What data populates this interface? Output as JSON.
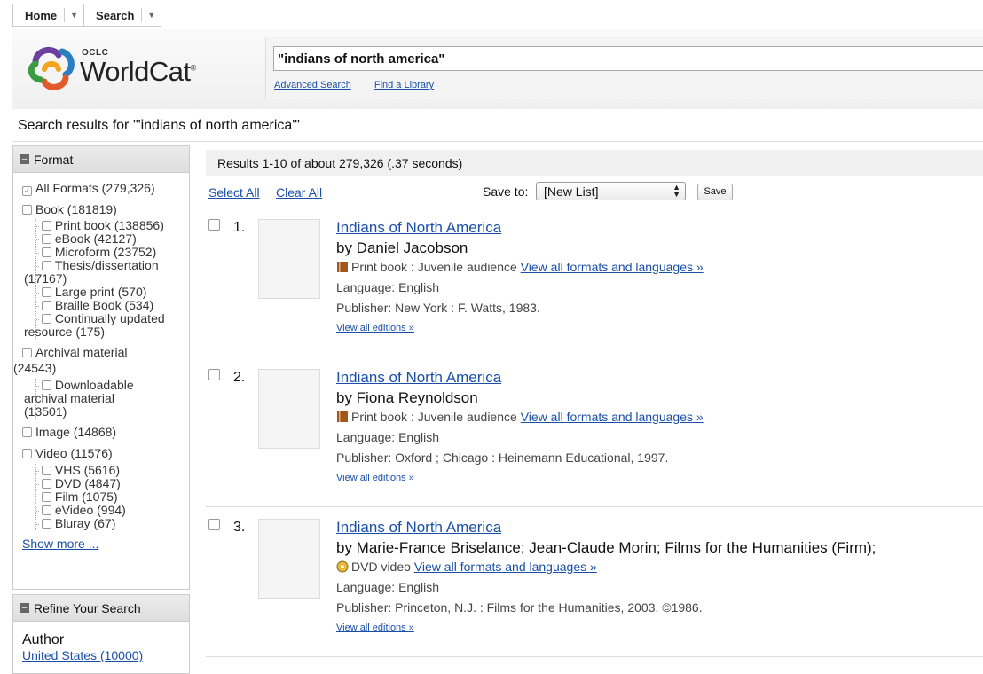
{
  "nav": {
    "home": "Home",
    "search": "Search"
  },
  "brand": {
    "oclc": "OCLC",
    "name": "WorldCat",
    "mark": "®"
  },
  "search": {
    "query": "\"indians of north america\"",
    "advanced": "Advanced Search",
    "find_library": "Find a Library"
  },
  "results_for": "Search results for '\"indians of north america\"'",
  "format_facet": {
    "heading": "Format",
    "items": [
      {
        "label": "All Formats (279,326)",
        "checked": true
      },
      {
        "label": "Book (181819)"
      },
      {
        "label": "Print book (138856)"
      },
      {
        "label": "eBook (42127)"
      },
      {
        "label": "Microform (23752)"
      },
      {
        "label": "Thesis/dissertation"
      },
      {
        "label": "(17167)"
      },
      {
        "label": "Large print (570)"
      },
      {
        "label": "Braille Book (534)"
      },
      {
        "label": "Continually updated"
      },
      {
        "label": "resource (175)"
      },
      {
        "label": "Archival material"
      },
      {
        "label": "(24543)"
      },
      {
        "label": "Downloadable"
      },
      {
        "label": "archival material"
      },
      {
        "label": "(13501)"
      },
      {
        "label": "Image (14868)"
      },
      {
        "label": "Video (11576)"
      },
      {
        "label": "VHS (5616)"
      },
      {
        "label": "DVD (4847)"
      },
      {
        "label": "Film (1075)"
      },
      {
        "label": "eVideo (994)"
      },
      {
        "label": "Bluray (67)"
      }
    ],
    "show_more": "Show more ..."
  },
  "refine": {
    "heading": "Refine Your Search",
    "author": "Author",
    "author_first": "United States (10000)"
  },
  "results": {
    "summary": "Results 1-10 of about 279,326 (.37 seconds)",
    "select_all": "Select All",
    "clear_all": "Clear All",
    "save_to": "Save to:",
    "list_value": "[New List]",
    "save_button": "Save"
  },
  "records": [
    {
      "num": "1.",
      "title": "Indians of North America",
      "author": "by Daniel Jacobson",
      "format": "Print book : Juvenile audience",
      "formats_link": "View all formats and languages »",
      "language": "Language: English",
      "publisher": "Publisher: New York : F. Watts, 1983.",
      "editions": "View all editions »"
    },
    {
      "num": "2.",
      "title": "Indians of North America",
      "author": "by Fiona Reynoldson",
      "format": "Print book : Juvenile audience",
      "formats_link": "View all formats and languages »",
      "language": "Language: English",
      "publisher": "Publisher: Oxford ; Chicago : Heinemann Educational, 1997.",
      "editions": "View all editions »"
    },
    {
      "num": "3.",
      "title": "Indians of North America",
      "author": "by Marie-France Briselance; Jean-Claude Morin; Films for the Humanities (Firm);",
      "format": "DVD video",
      "formats_link": "View all formats and languages »",
      "language": "Language: English",
      "publisher": "Publisher: Princeton, N.J. : Films for the Humanities, 2003, ©1986.",
      "editions": "View all editions »"
    }
  ],
  "icons": {
    "book": "book-icon",
    "dvd": "dvd-icon",
    "logo_colors": [
      "#6b3fa0",
      "#e05a2b",
      "#f2a51c",
      "#3a9c3e",
      "#2b7fc1"
    ]
  }
}
